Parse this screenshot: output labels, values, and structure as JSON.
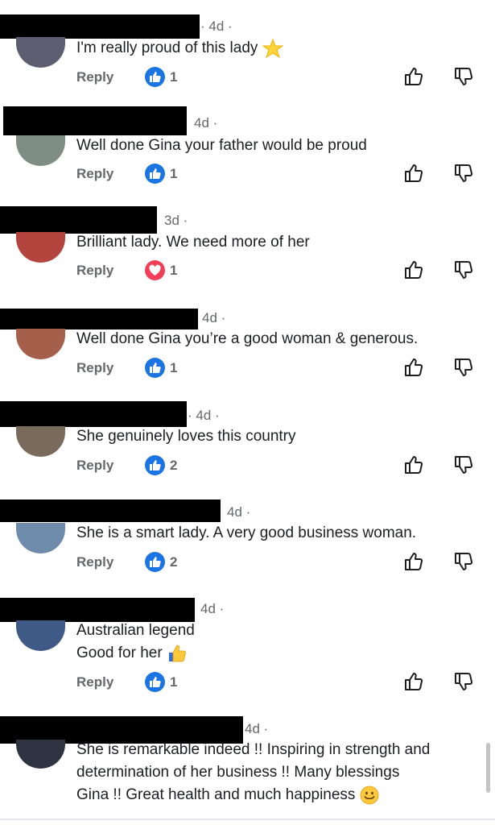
{
  "comments": [
    {
      "time": "· 4d ·",
      "text": "I'm really proud of this lady",
      "reply": "Reply",
      "reaction": "like",
      "count": "1"
    },
    {
      "time": "4d ·",
      "text": "Well done Gina  your father would be proud",
      "reply": "Reply",
      "reaction": "like",
      "count": "1"
    },
    {
      "time": "3d ·",
      "text": "Brilliant lady. We need more of her",
      "reply": "Reply",
      "reaction": "love",
      "count": "1"
    },
    {
      "time": "4d ·",
      "text": "Well done Gina you’re a good woman & generous.",
      "reply": "Reply",
      "reaction": "like",
      "count": "1"
    },
    {
      "time": "· 4d ·",
      "text": "She genuinely loves this country",
      "reply": "Reply",
      "reaction": "like",
      "count": "2"
    },
    {
      "time": "4d ·",
      "text": "She is a smart lady. A very good business woman.",
      "reply": "Reply",
      "reaction": "like",
      "count": "2"
    },
    {
      "time": "4d ·",
      "lines": [
        "Australian legend",
        "Good for her"
      ],
      "reply": "Reply",
      "reaction": "like",
      "count": "1"
    },
    {
      "time": "4d ·",
      "lines": [
        "She is remarkable indeed !!  Inspiring in strength and",
        "determination of her business !!  Many blessings",
        "Gina !!  Great health and much happiness"
      ]
    }
  ],
  "colors": {
    "like": "#1b74e4",
    "love": "#f33e58",
    "meta": "#65676b"
  },
  "icons": [
    "like-reaction-icon",
    "love-reaction-icon",
    "thumbs-up-outline-icon",
    "thumbs-down-outline-icon",
    "star-emoji-icon",
    "thumbs-up-emoji-icon",
    "smiley-emoji-icon"
  ]
}
